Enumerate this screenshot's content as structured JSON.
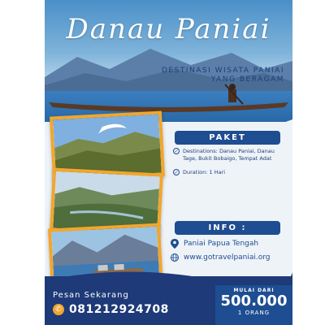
{
  "header": {
    "title": "Danau Paniai",
    "subtitle_line1": "DESTINASI WISATA PANIAI",
    "subtitle_line2": "YANG BERAGAM"
  },
  "paket": {
    "label": "PAKET",
    "destinations": "Destinations: Danau Paniai, Danau Tage, Bukit Bobaigo, Tempat Adat",
    "duration": "Duration: 1 Hari"
  },
  "info": {
    "label": "INFO :",
    "location": "Paniai Papua Tengah",
    "website": "www.gotravelpaniai.org"
  },
  "contact": {
    "cta": "Pesan Sekarang",
    "phone": "081212924708"
  },
  "price": {
    "prefix": "MULAI DARI",
    "amount": "500.000",
    "unit": "1 ORANG"
  },
  "colors": {
    "primary": "#1e4d91",
    "accent": "#f2a62c",
    "footer": "#1e3a78"
  }
}
